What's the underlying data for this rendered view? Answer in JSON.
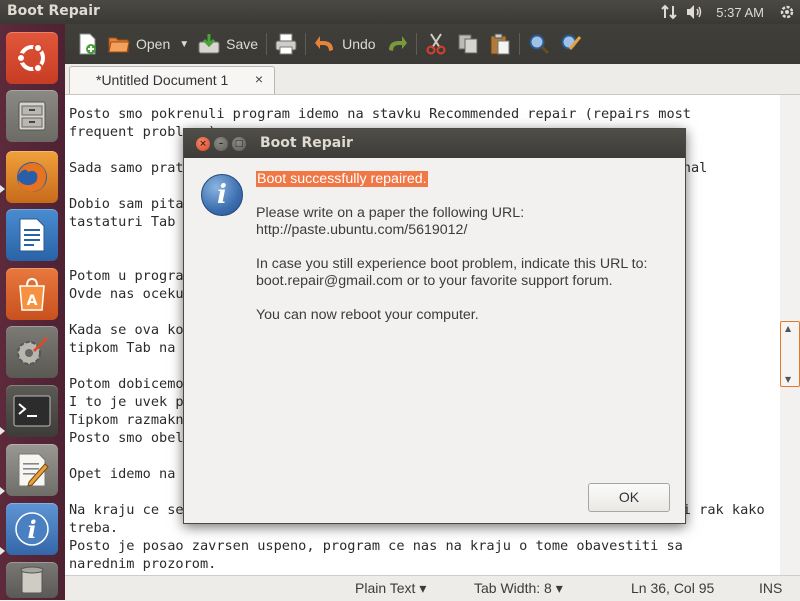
{
  "top_panel": {
    "app_title": "Boot Repair",
    "clock": "5:37 AM",
    "tray_icons": [
      "network-updown-icon",
      "volume-icon",
      "power-gear-icon"
    ]
  },
  "launcher": {
    "items": [
      {
        "name": "dash-home",
        "icon": "ubuntu-logo-icon",
        "running": false
      },
      {
        "name": "files",
        "icon": "file-cabinet-icon",
        "running": false
      },
      {
        "name": "firefox",
        "icon": "firefox-icon",
        "running": true
      },
      {
        "name": "libreoffice-writer",
        "icon": "writer-doc-icon",
        "running": false
      },
      {
        "name": "software-center",
        "icon": "shopping-bag-icon",
        "running": false
      },
      {
        "name": "system-settings",
        "icon": "settings-wrench-icon",
        "running": false
      },
      {
        "name": "terminal",
        "icon": "terminal-icon",
        "running": true
      },
      {
        "name": "gedit",
        "icon": "text-editor-icon",
        "running": true
      },
      {
        "name": "boot-repair",
        "icon": "info-icon",
        "running": true
      },
      {
        "name": "trash",
        "icon": "trash-icon",
        "running": false
      }
    ]
  },
  "toolbar": {
    "new_icon": "new-document-icon",
    "open_label": "Open",
    "save_label": "Save",
    "print_icon": "print-icon",
    "undo_label": "Undo",
    "redo_icon": "redo-icon",
    "cut_icon": "cut-icon",
    "copy_icon": "copy-icon",
    "paste_icon": "paste-icon",
    "find_icon": "find-icon",
    "replace_icon": "find-replace-icon"
  },
  "tab": {
    "label": "*Untitled Document 1",
    "close": "×"
  },
  "editor": {
    "lines": [
      "Posto smo pokrenuli program idemo na stavku Recommended repair (repairs most",
      "frequent problems).",
      "",
      "Sada samo pratimo uputstva u prozoru i kopiramo komande koje izlaze u terminal",
      "",
      "Dobio sam pitanje da li zelim da uklonim staru verziju GRUB-a i tipkom na",
      "tastaturi Tab na Yes.",
      "",
      "",
      "Potom u programu Boot Repair kliknemo Forward.",
      "Ovde nas ocekuje nova komanda koju kopiramo i izvrsimo u terminal",
      "",
      "Kada se ova komanda izvrsi u terminalu izlazi nam prozor gde sa",
      "tipkom Tab na OK.",
      "",
      "Potom dobicemo pitanje da li zelimo da instaliramo novi GRUB.",
      "I to je uvek potvrdno.",
      "Tipkom razmaknice selektujemo prvi disk u listi /dev/sda",
      "Posto smo obelezili disk idemo na OK.",
      "",
      "Opet idemo na Forward u Boot Repair.",
      "",
      "Na kraju ce se pojaviti obavestenje da je sve proslo kao sto je zamisljeno i rak kako",
      "treba.",
      "Posto je posao zavrsen uspeno, program ce nas na kraju o tome obavestiti sa",
      "narednim prozorom."
    ]
  },
  "statusbar": {
    "language": "Plain Text ▾",
    "tab_width": "Tab Width:  8 ▾",
    "position": "Ln 36, Col 95",
    "mode": "INS"
  },
  "dialog": {
    "title": "Boot Repair",
    "highlight": "Boot successfully repaired.",
    "line1": "Please write on a paper the following URL:",
    "url": "http://paste.ubuntu.com/5619012/",
    "line2": "In case you still experience boot problem, indicate this URL to:",
    "line3": "boot.repair@gmail.com or to your favorite support forum.",
    "line4": "You can now reboot your computer.",
    "ok_label": "OK",
    "close_symbol": "×",
    "minimize_symbol": "–",
    "maximize_symbol": "□"
  },
  "colors": {
    "accent": "#f07746",
    "launcher_bg": "#5c2a3b",
    "panel_bg": "#3c3b37"
  }
}
